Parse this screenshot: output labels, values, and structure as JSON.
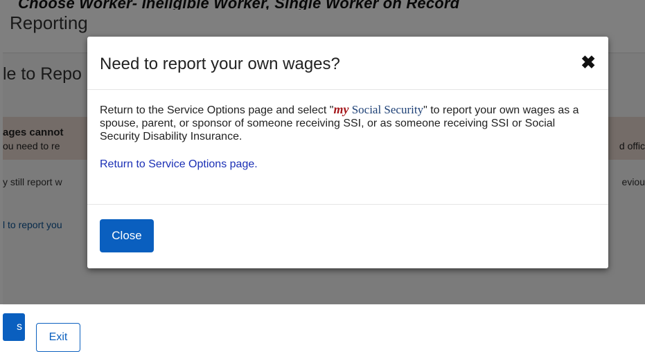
{
  "document": {
    "caption": "Choose Worker- Ineligible Worker, Single Worker on Record"
  },
  "background": {
    "heading": "Reporting",
    "panel_title": "le to Repo",
    "alert_strong": "ages cannot",
    "alert_text": "ou need to re",
    "alert_text_right": "d offic",
    "text_line": "y still report w",
    "text_line_right": "eviou",
    "link": "l to report you",
    "primary_button": "s",
    "exit_button": "Exit"
  },
  "modal": {
    "title": "Need to report your own wages?",
    "close_icon": "✖",
    "body": {
      "prefix": "Return to the Service Options page and select \"",
      "brand_my": "my",
      "brand_social_security": " Social Security",
      "suffix": "\" to report your own wages as a spouse, parent, or sponsor of someone receiving SSI, or as someone receiving SSI or Social Security Disability Insurance.",
      "link": "Return to Service Options page."
    },
    "close_button": "Close"
  },
  "colors": {
    "primary": "#0a5fbf",
    "brand_red": "#a4161a",
    "link": "#1a2fb5"
  }
}
